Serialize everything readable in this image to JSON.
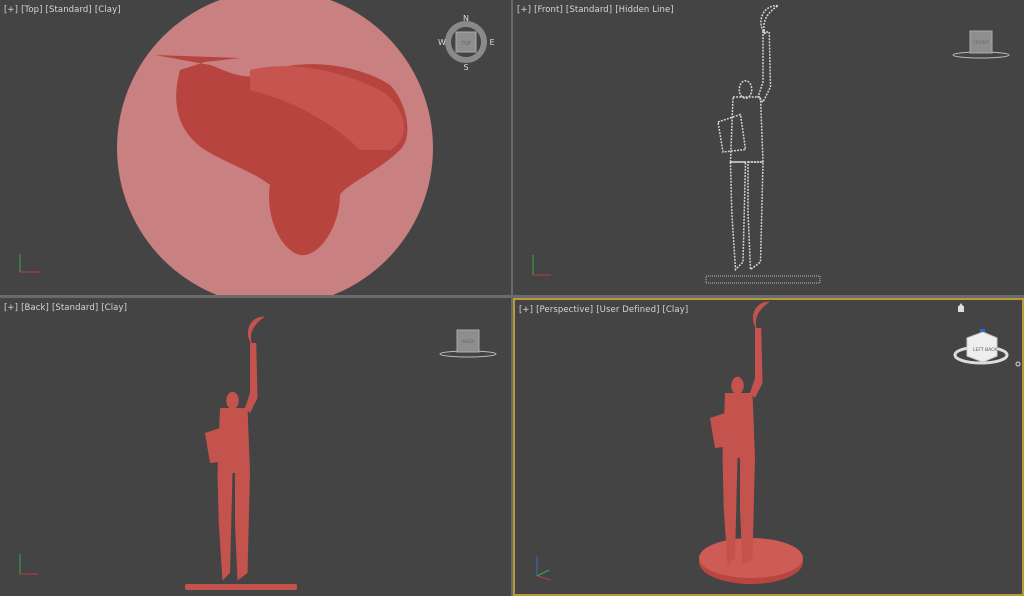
{
  "viewports": [
    {
      "id": "top",
      "menu": "[+]",
      "view": "[Top]",
      "shading": "[Standard]",
      "style": "[Clay]",
      "navigator": {
        "type": "viewcompass",
        "face": "TOP",
        "n": "N",
        "s": "S",
        "e": "E",
        "w": "W"
      }
    },
    {
      "id": "front",
      "menu": "[+]",
      "view": "[Front]",
      "shading": "[Standard]",
      "style": "[Hidden Line]",
      "navigator": {
        "type": "viewcube",
        "face": "FRONT"
      }
    },
    {
      "id": "back",
      "menu": "[+]",
      "view": "[Back]",
      "shading": "[Standard]",
      "style": "[Clay]",
      "navigator": {
        "type": "viewcube",
        "face": "BACK"
      }
    },
    {
      "id": "perspective",
      "menu": "[+]",
      "view": "[Perspective]",
      "shading": "[User Defined]",
      "style": "[Clay]",
      "active": true,
      "navigator": {
        "type": "viewcube",
        "face_left": "LEFT",
        "face_right": "BACK"
      }
    }
  ],
  "colors": {
    "viewport_bg": "#444444",
    "clay": "#c4534d",
    "active_border": "#b59a3c",
    "top_disc": "#c98080"
  }
}
